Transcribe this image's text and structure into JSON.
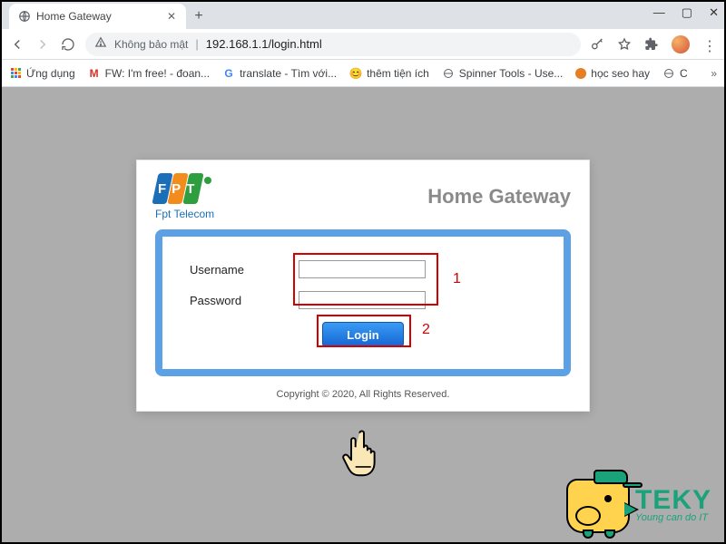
{
  "browser": {
    "tab_title": "Home Gateway",
    "address": {
      "security_text": "Không bảo mật",
      "url": "192.168.1.1/login.html"
    },
    "bookmarks": {
      "apps": "Ứng dụng",
      "items": [
        {
          "label": "FW: I'm free! - đoan..."
        },
        {
          "label": "translate - Tìm với..."
        },
        {
          "label": "thêm tiện ích"
        },
        {
          "label": "Spinner Tools - Use..."
        },
        {
          "label": "học seo hay"
        },
        {
          "label": "C"
        }
      ]
    }
  },
  "page": {
    "brand_sub": "Fpt Telecom",
    "title": "Home Gateway",
    "username_label": "Username",
    "password_label": "Password",
    "login_button": "Login",
    "copyright": "Copyright © 2020,              All Rights Reserved."
  },
  "annotations": {
    "num1": "1",
    "num2": "2"
  },
  "watermark": {
    "name": "TEKY",
    "slogan": "Young can do IT"
  }
}
